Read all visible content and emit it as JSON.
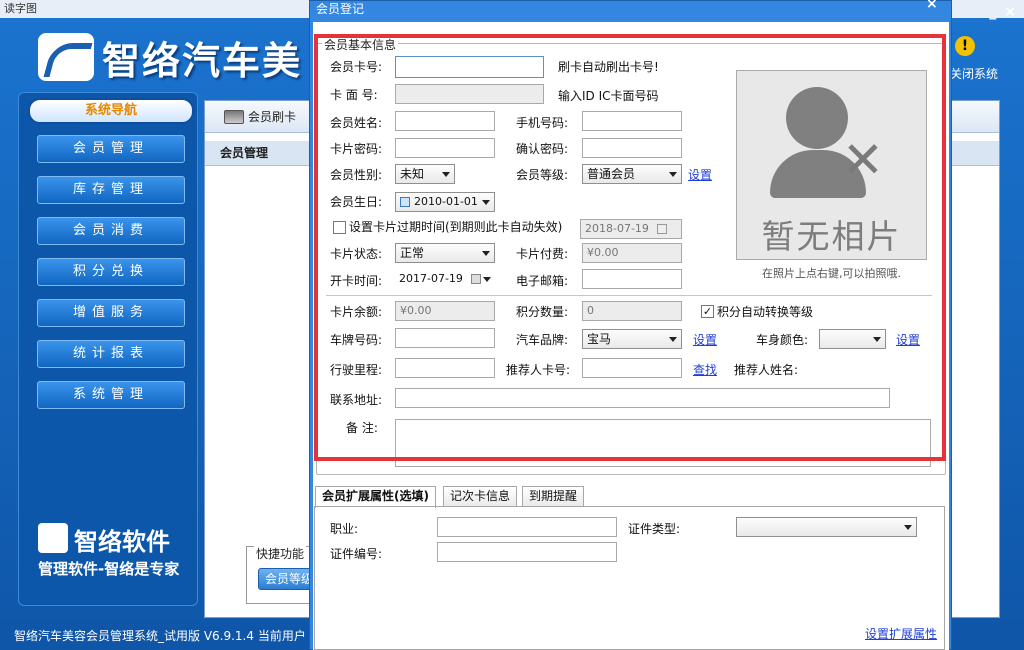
{
  "app": {
    "top_strip": "读字图",
    "title": "智络汽车美",
    "exit_label": "关闭系统",
    "status_text": "智络汽车美容会员管理系统_试用版 V6.9.1.4 当前用户",
    "controls": {
      "minimize": "_",
      "close": "×"
    }
  },
  "sidebar": {
    "header": "系统导航",
    "items": [
      {
        "label": "会员管理"
      },
      {
        "label": "库存管理"
      },
      {
        "label": "会员消费"
      },
      {
        "label": "积分兑换"
      },
      {
        "label": "增值服务"
      },
      {
        "label": "统计报表"
      },
      {
        "label": "系统管理"
      }
    ],
    "brand_name": "智络软件",
    "brand_slogan": "管理软件-智络是专家"
  },
  "main": {
    "tab_label": "会员刷卡",
    "sub_header": "会员管理",
    "quick_title": "快捷功能",
    "quick_button": "会员等级"
  },
  "dialog": {
    "title": "会员登记",
    "close": "×",
    "group_title": "会员基本信息",
    "fields": {
      "card_no_label": "会员卡号:",
      "card_no_value": "",
      "card_hint": "刷卡自动刷出卡号!",
      "card_face_label": "卡 面 号:",
      "card_face_value": "",
      "card_face_hint": "输入ID IC卡面号码",
      "name_label": "会员姓名:",
      "phone_label": "手机号码:",
      "password_label": "卡片密码:",
      "confirm_label": "确认密码:",
      "gender_label": "会员性别:",
      "gender_value": "未知",
      "level_label": "会员等级:",
      "level_value": "普通会员",
      "level_link": "设置",
      "birthday_label": "会员生日:",
      "birthday_value": "2010-01-01",
      "expire_check_label": "设置卡片过期时间(到期则此卡自动失效)",
      "expire_value": "2018-07-19",
      "status_label": "卡片状态:",
      "status_value": "正常",
      "fee_label": "卡片付费:",
      "fee_value": "¥0.00",
      "open_label": "开卡时间:",
      "open_value": "2017-07-19",
      "email_label": "电子邮箱:",
      "balance_label": "卡片余额:",
      "balance_value": "¥0.00",
      "points_label": "积分数量:",
      "points_value": "0",
      "auto_level_label": "积分自动转换等级",
      "plate_label": "车牌号码:",
      "brand_label": "汽车品牌:",
      "brand_value": "宝马",
      "brand_link": "设置",
      "color_label": "车身颜色:",
      "color_value": "",
      "color_link": "设置",
      "mileage_label": "行驶里程:",
      "referrer_label": "推荐人卡号:",
      "referrer_link": "查找",
      "referrer_name_label": "推荐人姓名:",
      "address_label": "联系地址:",
      "note_label": "备  注:"
    },
    "photo": {
      "placeholder_text": "暂无相片",
      "hint": "在照片上点右键,可以拍照哦."
    },
    "tabs": [
      {
        "label": "会员扩展属性(选填)"
      },
      {
        "label": "记次卡信息"
      },
      {
        "label": "到期提醒"
      }
    ],
    "ext": {
      "job_label": "职业:",
      "id_type_label": "证件类型:",
      "id_type_value": "",
      "id_no_label": "证件编号:",
      "ext_link": "设置扩展属性"
    }
  }
}
